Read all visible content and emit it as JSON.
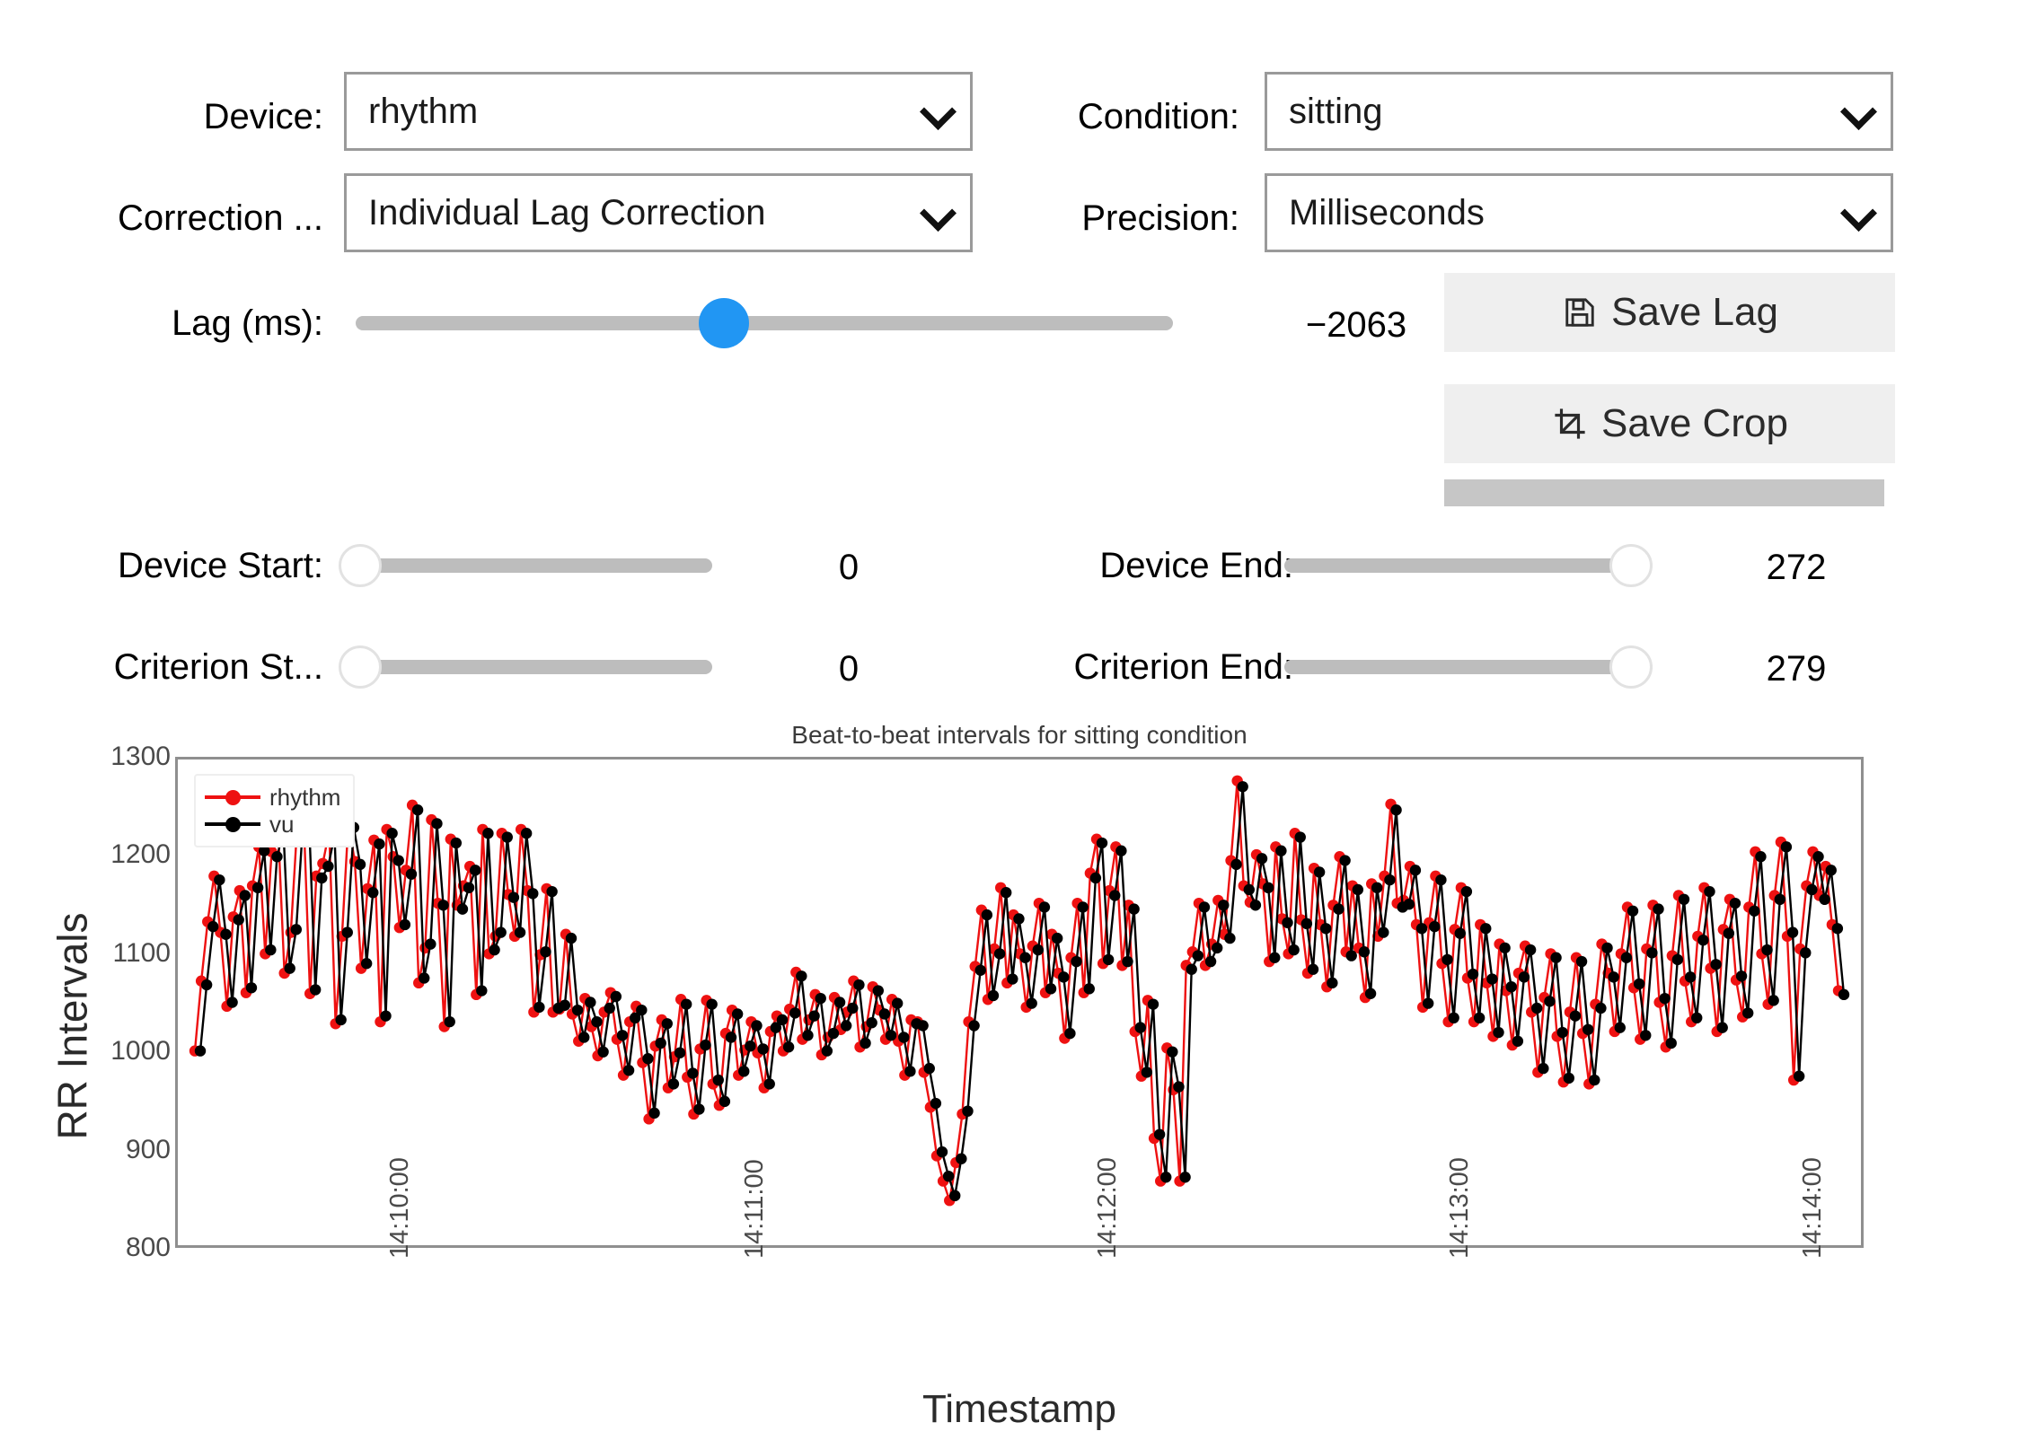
{
  "controls": {
    "device": {
      "label": "Device:",
      "value": "rhythm"
    },
    "condition": {
      "label": "Condition:",
      "value": "sitting"
    },
    "correction": {
      "label": "Correction ...",
      "value": "Individual Lag Correction"
    },
    "precision": {
      "label": "Precision:",
      "value": "Milliseconds"
    },
    "lag": {
      "label": "Lag (ms):",
      "value": "−2063"
    },
    "save_lag": {
      "label": "Save Lag",
      "icon": "floppy-disk-icon"
    },
    "save_crop": {
      "label": "Save Crop",
      "icon": "crop-icon"
    },
    "device_start": {
      "label": "Device Start:",
      "value": "0"
    },
    "device_end": {
      "label": "Device End:",
      "value": "272"
    },
    "criterion_start": {
      "label": "Criterion St...",
      "value": "0"
    },
    "criterion_end": {
      "label": "Criterion End:",
      "value": "279"
    }
  },
  "colors": {
    "accent": "#2196f3",
    "series_rhythm": "#ee1111",
    "series_vu": "#000000",
    "track": "#bdbdbd",
    "button_bg": "#efefef",
    "progress": "#c6c6c6"
  },
  "chart_data": {
    "type": "line",
    "title": "Beat-to-beat intervals for sitting condition",
    "xlabel": "Timestamp",
    "ylabel": "RR Intervals",
    "ylim": [
      800,
      1300
    ],
    "yticks": [
      1300,
      1200,
      1100,
      1000,
      900,
      800
    ],
    "xticks": [
      "14:10:00",
      "14:11:00",
      "14:12:00",
      "14:13:00",
      "14:14:00"
    ],
    "xtick_positions": [
      0.118,
      0.328,
      0.537,
      0.746,
      0.955
    ],
    "grid": false,
    "legend": "upper left",
    "series": [
      {
        "name": "rhythm",
        "color": "#ee1111",
        "values": [
          1000,
          1072,
          1133,
          1180,
          1122,
          1046,
          1138,
          1165,
          1060,
          1170,
          1210,
          1100,
          1205,
          1230,
          1080,
          1122,
          1232,
          1242,
          1059,
          1180,
          1193,
          1226,
          1028,
          1118,
          1235,
          1195,
          1085,
          1167,
          1217,
          1030,
          1228,
          1200,
          1127,
          1186,
          1253,
          1070,
          1106,
          1238,
          1152,
          1025,
          1218,
          1150,
          1170,
          1190,
          1058,
          1228,
          1100,
          1118,
          1224,
          1161,
          1118,
          1228,
          1165,
          1040,
          1099,
          1167,
          1040,
          1043,
          1120,
          1038,
          1010,
          1054,
          1025,
          995,
          1040,
          1060,
          1012,
          975,
          1030,
          1046,
          988,
          930,
          1005,
          1032,
          962,
          994,
          1053,
          973,
          935,
          1002,
          1052,
          966,
          944,
          1018,
          1042,
          975,
          1001,
          1030,
          998,
          962,
          1020,
          1036,
          1000,
          1043,
          1081,
          1012,
          1032,
          1058,
          996,
          1014,
          1055,
          1022,
          1040,
          1072,
          1004,
          1025,
          1066,
          1042,
          1012,
          1053,
          1010,
          975,
          1032,
          1030,
          978,
          942,
          892,
          866,
          846,
          885,
          935,
          1030,
          1087,
          1145,
          1053,
          1105,
          1168,
          1070,
          1140,
          1100,
          1045,
          1108,
          1152,
          1060,
          1120,
          1080,
          1013,
          1096,
          1152,
          1060,
          1183,
          1218,
          1090,
          1165,
          1210,
          1088,
          1150,
          1020,
          974,
          1052,
          910,
          866,
          1003,
          960,
          866,
          1088,
          1102,
          1152,
          1088,
          1110,
          1155,
          1120,
          1196,
          1278,
          1170,
          1153,
          1202,
          1172,
          1092,
          1210,
          1136,
          1100,
          1224,
          1135,
          1080,
          1188,
          1130,
          1066,
          1150,
          1200,
          1102,
          1170,
          1106,
          1055,
          1172,
          1118,
          1180,
          1254,
          1152,
          1155,
          1190,
          1130,
          1045,
          1132,
          1180,
          1090,
          1030,
          1125,
          1168,
          1075,
          1030,
          1130,
          1070,
          1015,
          1110,
          1062,
          1006,
          1080,
          1108,
          1040,
          978,
          1055,
          1100,
          1015,
          968,
          1040,
          1096,
          1018,
          966,
          1048,
          1110,
          1080,
          1020,
          1100,
          1148,
          1065,
          1012,
          1105,
          1150,
          1050,
          1004,
          1098,
          1160,
          1072,
          1030,
          1118,
          1168,
          1085,
          1020,
          1125,
          1156,
          1073,
          1035,
          1148,
          1205,
          1100,
          1048,
          1160,
          1215,
          1118,
          970,
          1105,
          1170,
          1205,
          1160,
          1190,
          1130,
          1062
        ]
      },
      {
        "name": "vu",
        "color": "#000000",
        "values": [
          1000,
          1068,
          1128,
          1176,
          1120,
          1050,
          1135,
          1160,
          1065,
          1168,
          1206,
          1104,
          1200,
          1226,
          1085,
          1125,
          1228,
          1238,
          1063,
          1178,
          1190,
          1222,
          1032,
          1122,
          1230,
          1192,
          1090,
          1163,
          1213,
          1036,
          1224,
          1196,
          1130,
          1182,
          1248,
          1075,
          1110,
          1234,
          1150,
          1030,
          1214,
          1146,
          1168,
          1186,
          1062,
          1224,
          1104,
          1122,
          1220,
          1158,
          1122,
          1224,
          1162,
          1045,
          1102,
          1164,
          1044,
          1047,
          1116,
          1042,
          1014,
          1050,
          1030,
          999,
          1044,
          1056,
          1016,
          980,
          1034,
          1042,
          992,
          936,
          1008,
          1028,
          966,
          998,
          1048,
          977,
          940,
          1006,
          1048,
          970,
          948,
          1014,
          1038,
          979,
          1005,
          1026,
          1002,
          966,
          1024,
          1032,
          1004,
          1039,
          1077,
          1016,
          1036,
          1054,
          1000,
          1018,
          1050,
          1026,
          1044,
          1068,
          1008,
          1029,
          1062,
          1038,
          1016,
          1049,
          1014,
          979,
          1028,
          1026,
          982,
          946,
          896,
          871,
          851,
          889,
          938,
          1026,
          1083,
          1140,
          1057,
          1100,
          1163,
          1074,
          1136,
          1096,
          1049,
          1104,
          1148,
          1064,
          1116,
          1076,
          1018,
          1092,
          1148,
          1064,
          1178,
          1214,
          1094,
          1160,
          1206,
          1092,
          1146,
          1024,
          978,
          1048,
          914,
          870,
          999,
          963,
          870,
          1084,
          1098,
          1148,
          1092,
          1106,
          1150,
          1116,
          1192,
          1272,
          1166,
          1150,
          1198,
          1168,
          1096,
          1206,
          1132,
          1104,
          1220,
          1131,
          1084,
          1184,
          1126,
          1070,
          1146,
          1196,
          1098,
          1166,
          1102,
          1059,
          1168,
          1122,
          1176,
          1248,
          1148,
          1151,
          1186,
          1126,
          1049,
          1128,
          1176,
          1094,
          1034,
          1121,
          1164,
          1079,
          1034,
          1126,
          1074,
          1019,
          1106,
          1066,
          1010,
          1076,
          1104,
          1044,
          982,
          1051,
          1096,
          1019,
          972,
          1036,
          1092,
          1022,
          970,
          1044,
          1106,
          1076,
          1024,
          1096,
          1144,
          1069,
          1016,
          1101,
          1146,
          1054,
          1008,
          1094,
          1156,
          1076,
          1034,
          1114,
          1164,
          1089,
          1024,
          1121,
          1152,
          1077,
          1039,
          1144,
          1200,
          1104,
          1052,
          1156,
          1210,
          1122,
          974,
          1101,
          1166,
          1200,
          1156,
          1186,
          1126,
          1058
        ]
      }
    ]
  }
}
